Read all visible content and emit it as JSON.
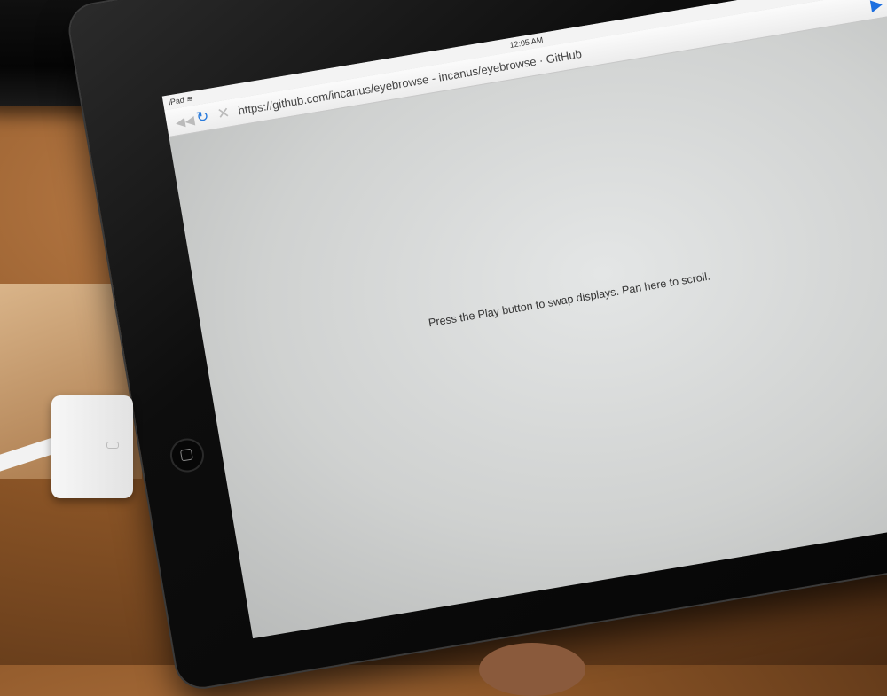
{
  "status_bar": {
    "device": "iPad",
    "wifi_icon": "wifi-icon",
    "time": "12:05 AM",
    "right_icons": "☾ ◉ ➤ ▮"
  },
  "toolbar": {
    "back_icon": "◀◀",
    "reload_icon": "↻",
    "stop_icon": "✕",
    "url": "https://github.com/incanus/eyebrowse - incanus/eyebrowse · GitHub",
    "play_icon": "play-icon"
  },
  "content": {
    "message": "Press the Play button to swap displays. Pan here to scroll."
  },
  "colors": {
    "accent": "#1d6fe0",
    "screen_bg": "#dcdede"
  }
}
